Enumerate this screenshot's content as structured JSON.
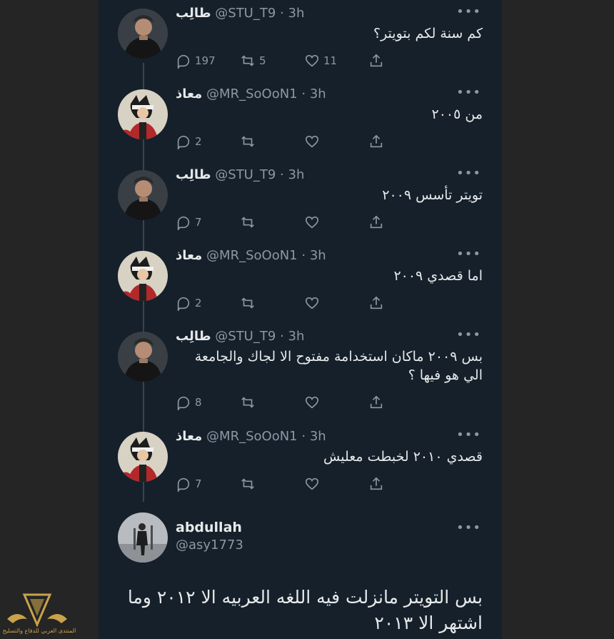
{
  "tweets": [
    {
      "name": "طالِب",
      "handle": "@STU_T9",
      "time": "3h",
      "text": "كم سنة لكم بتويتر؟",
      "replies": "197",
      "retweets": "5",
      "likes": "11",
      "avatar": "person-photo"
    },
    {
      "name": "معاذ",
      "handle": "@MR_SoOoN1",
      "time": "3h",
      "text": "من ٢٠٠٥",
      "replies": "2",
      "retweets": "",
      "likes": "",
      "avatar": "cartoon-character"
    },
    {
      "name": "طالِب",
      "handle": "@STU_T9",
      "time": "3h",
      "text": "تويتر تأسس ٢٠٠٩",
      "replies": "7",
      "retweets": "",
      "likes": "",
      "avatar": "person-photo"
    },
    {
      "name": "معاذ",
      "handle": "@MR_SoOoN1",
      "time": "3h",
      "text": "اما قصدي ٢٠٠٩",
      "replies": "2",
      "retweets": "",
      "likes": "",
      "avatar": "cartoon-character"
    },
    {
      "name": "طالِب",
      "handle": "@STU_T9",
      "time": "3h",
      "text": "بس ٢٠٠٩ ماكان استخدامة مفتوح الا لجاك والجامعة الي هو فيها ؟",
      "replies": "8",
      "retweets": "",
      "likes": "",
      "avatar": "person-photo"
    },
    {
      "name": "معاذ",
      "handle": "@MR_SoOoN1",
      "time": "3h",
      "text": "قصدي ٢٠١٠ لخبطت معليش",
      "replies": "7",
      "retweets": "",
      "likes": "",
      "avatar": "cartoon-character"
    }
  ],
  "main_tweet": {
    "name": "abdullah",
    "handle": "@asy1773",
    "text": "بس التويتر مانزلت فيه اللغه العربيه الا ٢٠١٢ وما اشتهر الا ٢٠١٣",
    "avatar": "person-in-snow"
  },
  "separator": "·",
  "more_glyph": "•••",
  "watermark": {
    "text": "المنتدى العربي للدفاع والتسليح"
  },
  "colors": {
    "background": "#15202b",
    "text": "#e7e9ea",
    "muted": "#8b98a5",
    "line": "#38444d",
    "gold": "#c9a24a"
  }
}
